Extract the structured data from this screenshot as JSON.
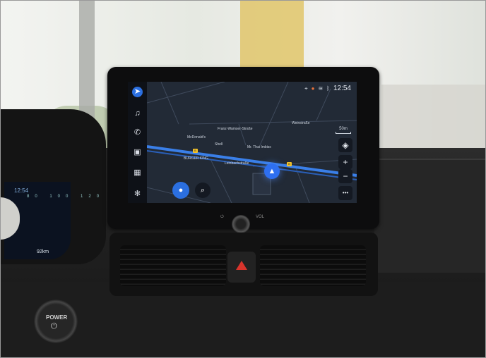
{
  "status_bar": {
    "time": "12:54",
    "icons": [
      "location-icon",
      "alert-icon",
      "wifi-icon",
      "bluetooth-icon"
    ]
  },
  "rail": {
    "items": [
      "navigation-icon",
      "music-icon",
      "phone-icon",
      "car-icon",
      "apps-grid-icon",
      "settings-icon"
    ]
  },
  "map": {
    "scale": "50m",
    "labels": {
      "mcdonalds": "McDonald's",
      "shell": "Shell",
      "burger_king": "BURGER KING",
      "thai": "Mr. Thai Imbiss",
      "street_top": "Weinstraße",
      "street_mid": "Franz-Wamser-Straße",
      "street_low": "Leinbachstraße"
    },
    "road_marker": "B",
    "controls": {
      "zoom_in": "+",
      "zoom_out": "−",
      "more": "•••"
    }
  },
  "hardware": {
    "vol_label": "VOL",
    "power_label": "POWER"
  },
  "cluster": {
    "time": "12:54",
    "speed_ticks": "80 100 120 140",
    "range": "92km"
  },
  "colors": {
    "accent": "#2b6fe0",
    "route": "#3a7fe8",
    "hazard": "#d8342c"
  }
}
